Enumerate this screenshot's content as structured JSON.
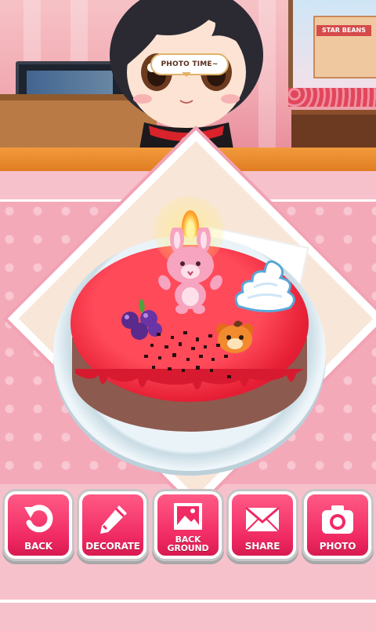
{
  "scene": {
    "speech_bubble": "PHOTO TIME~",
    "shop_sign": "STAR BEANS"
  },
  "toolbar": {
    "back": "BACK",
    "decorate": "DECORATE",
    "background_line1": "BACK",
    "background_line2": "GROUND",
    "share": "SHARE",
    "photo": "PHOTO"
  },
  "icons": {
    "back": "undo-arrow-icon",
    "decorate": "pencil-icon",
    "background": "picture-icon",
    "share": "envelope-icon",
    "photo": "camera-icon"
  },
  "colors": {
    "button": "#f02a63",
    "cake_glaze": "#e61f35",
    "board": "#f4a9b9"
  }
}
